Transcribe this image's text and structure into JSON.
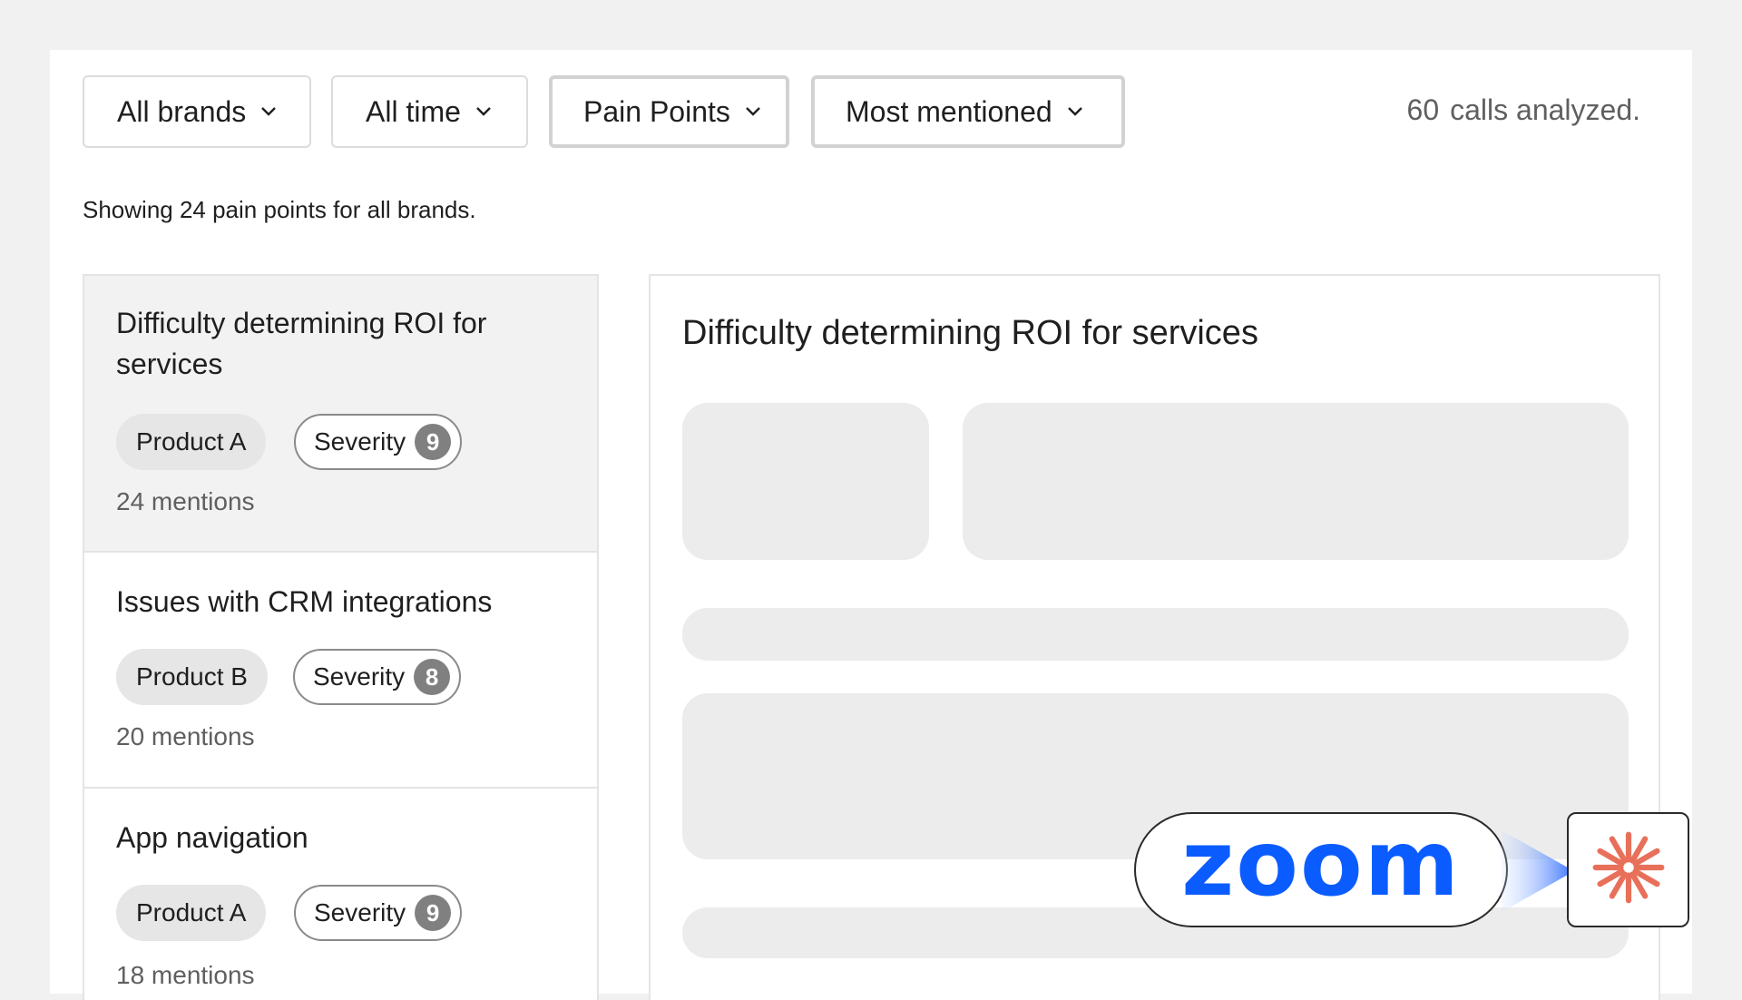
{
  "filters": {
    "brand": "All brands",
    "time": "All time",
    "category": "Pain Points",
    "sort": "Most mentioned"
  },
  "calls": {
    "count": "60",
    "label": "calls analyzed."
  },
  "summary": "Showing 24 pain points for all brands.",
  "severity_label": "Severity",
  "items": [
    {
      "title": "Difficulty determining ROI for services",
      "product": "Product A",
      "severity": "9",
      "mentions": "24 mentions"
    },
    {
      "title": "Issues with CRM integrations",
      "product": "Product B",
      "severity": "8",
      "mentions": "20 mentions"
    },
    {
      "title": "App navigation",
      "product": "Product A",
      "severity": "9",
      "mentions": "18 mentions"
    }
  ],
  "detail": {
    "title": "Difficulty determining ROI for services"
  },
  "integration": {
    "zoom_logo_text": "zoom"
  },
  "colors": {
    "zoom_blue": "#0b5cff",
    "accent_orange": "#e8705a",
    "severity_badge": "#808080"
  }
}
